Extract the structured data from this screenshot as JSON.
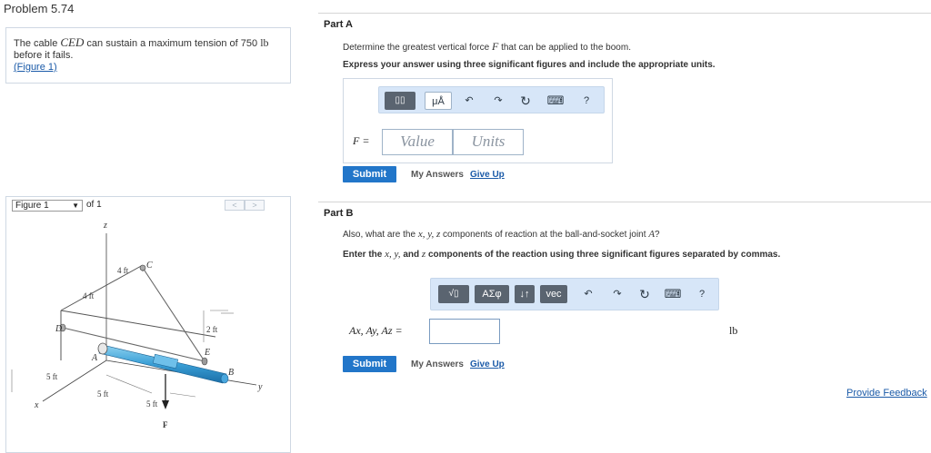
{
  "problem_title": "Problem 5.74",
  "statement": {
    "line1_a": "The cable ",
    "line1_var": "CED",
    "line1_b": " can sustain a maximum tension of 750 ",
    "line1_unit": "lb",
    "line2": "before it fails.",
    "figure_link": "(Figure 1)"
  },
  "figure_nav": {
    "select_value": "Figure 1",
    "of_label": "of 1",
    "prev": "<",
    "next": ">"
  },
  "figure": {
    "labels": {
      "z": "z",
      "x": "x",
      "y": "y",
      "C": "C",
      "D": "D",
      "A": "A",
      "E": "E",
      "B": "B",
      "F": "F",
      "dim_4ft_top": "4 ft",
      "dim_4ft_left": "4 ft",
      "dim_2ft": "2 ft",
      "dim_5ft_left": "5 ft",
      "dim_5ft_bottom": "5 ft",
      "dim_5ft_mid": "5 ft"
    }
  },
  "partA": {
    "title": "Part A",
    "prompt_a": "Determine the greatest vertical force ",
    "prompt_var": "F",
    "prompt_b": " that can be applied to the boom.",
    "instruction": "Express your answer using three significant figures and include the appropriate units.",
    "toolbar": {
      "templates": "▯▯",
      "mu": "μÅ",
      "undo": "↶",
      "redo": "↷",
      "reset": "↻",
      "keyboard": "⌨",
      "help": "?"
    },
    "label": "F =",
    "value_placeholder": "Value",
    "units_placeholder": "Units",
    "submit": "Submit",
    "my_answers": "My Answers",
    "give_up": "Give Up"
  },
  "partB": {
    "title": "Part B",
    "prompt_a": "Also, what are the ",
    "prompt_vars": "x, y, z",
    "prompt_b": " components of reaction at the ball-and-socket joint ",
    "prompt_var2": "A",
    "prompt_c": "?",
    "instruction_a": "Enter the ",
    "instruction_vars": "x, y,",
    "instruction_b": " and ",
    "instruction_var3": "z",
    "instruction_c": " components of the reaction using three significant figures separated by commas.",
    "toolbar": {
      "sqrt": "√▯",
      "greek": "ΑΣφ",
      "arrows": "↓↑",
      "vec": "vec",
      "undo": "↶",
      "redo": "↷",
      "reset": "↻",
      "keyboard": "⌨",
      "help": "?"
    },
    "label": "Ax, Ay, Az =",
    "unit": "lb",
    "submit": "Submit",
    "my_answers": "My Answers",
    "give_up": "Give Up"
  },
  "provide_feedback": "Provide Feedback"
}
